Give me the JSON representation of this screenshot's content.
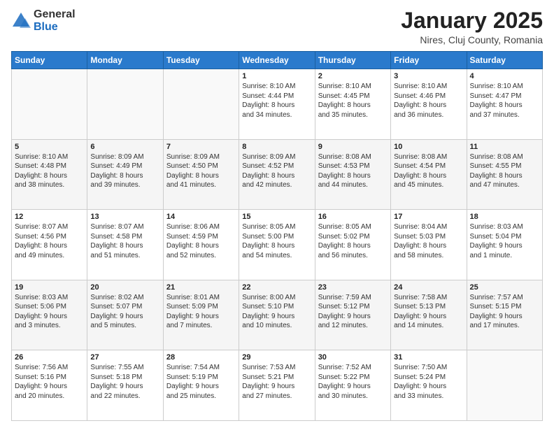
{
  "logo": {
    "general": "General",
    "blue": "Blue"
  },
  "header": {
    "title": "January 2025",
    "subtitle": "Nires, Cluj County, Romania"
  },
  "weekdays": [
    "Sunday",
    "Monday",
    "Tuesday",
    "Wednesday",
    "Thursday",
    "Friday",
    "Saturday"
  ],
  "weeks": [
    [
      {
        "day": "",
        "info": ""
      },
      {
        "day": "",
        "info": ""
      },
      {
        "day": "",
        "info": ""
      },
      {
        "day": "1",
        "info": "Sunrise: 8:10 AM\nSunset: 4:44 PM\nDaylight: 8 hours\nand 34 minutes."
      },
      {
        "day": "2",
        "info": "Sunrise: 8:10 AM\nSunset: 4:45 PM\nDaylight: 8 hours\nand 35 minutes."
      },
      {
        "day": "3",
        "info": "Sunrise: 8:10 AM\nSunset: 4:46 PM\nDaylight: 8 hours\nand 36 minutes."
      },
      {
        "day": "4",
        "info": "Sunrise: 8:10 AM\nSunset: 4:47 PM\nDaylight: 8 hours\nand 37 minutes."
      }
    ],
    [
      {
        "day": "5",
        "info": "Sunrise: 8:10 AM\nSunset: 4:48 PM\nDaylight: 8 hours\nand 38 minutes."
      },
      {
        "day": "6",
        "info": "Sunrise: 8:09 AM\nSunset: 4:49 PM\nDaylight: 8 hours\nand 39 minutes."
      },
      {
        "day": "7",
        "info": "Sunrise: 8:09 AM\nSunset: 4:50 PM\nDaylight: 8 hours\nand 41 minutes."
      },
      {
        "day": "8",
        "info": "Sunrise: 8:09 AM\nSunset: 4:52 PM\nDaylight: 8 hours\nand 42 minutes."
      },
      {
        "day": "9",
        "info": "Sunrise: 8:08 AM\nSunset: 4:53 PM\nDaylight: 8 hours\nand 44 minutes."
      },
      {
        "day": "10",
        "info": "Sunrise: 8:08 AM\nSunset: 4:54 PM\nDaylight: 8 hours\nand 45 minutes."
      },
      {
        "day": "11",
        "info": "Sunrise: 8:08 AM\nSunset: 4:55 PM\nDaylight: 8 hours\nand 47 minutes."
      }
    ],
    [
      {
        "day": "12",
        "info": "Sunrise: 8:07 AM\nSunset: 4:56 PM\nDaylight: 8 hours\nand 49 minutes."
      },
      {
        "day": "13",
        "info": "Sunrise: 8:07 AM\nSunset: 4:58 PM\nDaylight: 8 hours\nand 51 minutes."
      },
      {
        "day": "14",
        "info": "Sunrise: 8:06 AM\nSunset: 4:59 PM\nDaylight: 8 hours\nand 52 minutes."
      },
      {
        "day": "15",
        "info": "Sunrise: 8:05 AM\nSunset: 5:00 PM\nDaylight: 8 hours\nand 54 minutes."
      },
      {
        "day": "16",
        "info": "Sunrise: 8:05 AM\nSunset: 5:02 PM\nDaylight: 8 hours\nand 56 minutes."
      },
      {
        "day": "17",
        "info": "Sunrise: 8:04 AM\nSunset: 5:03 PM\nDaylight: 8 hours\nand 58 minutes."
      },
      {
        "day": "18",
        "info": "Sunrise: 8:03 AM\nSunset: 5:04 PM\nDaylight: 9 hours\nand 1 minute."
      }
    ],
    [
      {
        "day": "19",
        "info": "Sunrise: 8:03 AM\nSunset: 5:06 PM\nDaylight: 9 hours\nand 3 minutes."
      },
      {
        "day": "20",
        "info": "Sunrise: 8:02 AM\nSunset: 5:07 PM\nDaylight: 9 hours\nand 5 minutes."
      },
      {
        "day": "21",
        "info": "Sunrise: 8:01 AM\nSunset: 5:09 PM\nDaylight: 9 hours\nand 7 minutes."
      },
      {
        "day": "22",
        "info": "Sunrise: 8:00 AM\nSunset: 5:10 PM\nDaylight: 9 hours\nand 10 minutes."
      },
      {
        "day": "23",
        "info": "Sunrise: 7:59 AM\nSunset: 5:12 PM\nDaylight: 9 hours\nand 12 minutes."
      },
      {
        "day": "24",
        "info": "Sunrise: 7:58 AM\nSunset: 5:13 PM\nDaylight: 9 hours\nand 14 minutes."
      },
      {
        "day": "25",
        "info": "Sunrise: 7:57 AM\nSunset: 5:15 PM\nDaylight: 9 hours\nand 17 minutes."
      }
    ],
    [
      {
        "day": "26",
        "info": "Sunrise: 7:56 AM\nSunset: 5:16 PM\nDaylight: 9 hours\nand 20 minutes."
      },
      {
        "day": "27",
        "info": "Sunrise: 7:55 AM\nSunset: 5:18 PM\nDaylight: 9 hours\nand 22 minutes."
      },
      {
        "day": "28",
        "info": "Sunrise: 7:54 AM\nSunset: 5:19 PM\nDaylight: 9 hours\nand 25 minutes."
      },
      {
        "day": "29",
        "info": "Sunrise: 7:53 AM\nSunset: 5:21 PM\nDaylight: 9 hours\nand 27 minutes."
      },
      {
        "day": "30",
        "info": "Sunrise: 7:52 AM\nSunset: 5:22 PM\nDaylight: 9 hours\nand 30 minutes."
      },
      {
        "day": "31",
        "info": "Sunrise: 7:50 AM\nSunset: 5:24 PM\nDaylight: 9 hours\nand 33 minutes."
      },
      {
        "day": "",
        "info": ""
      }
    ]
  ]
}
